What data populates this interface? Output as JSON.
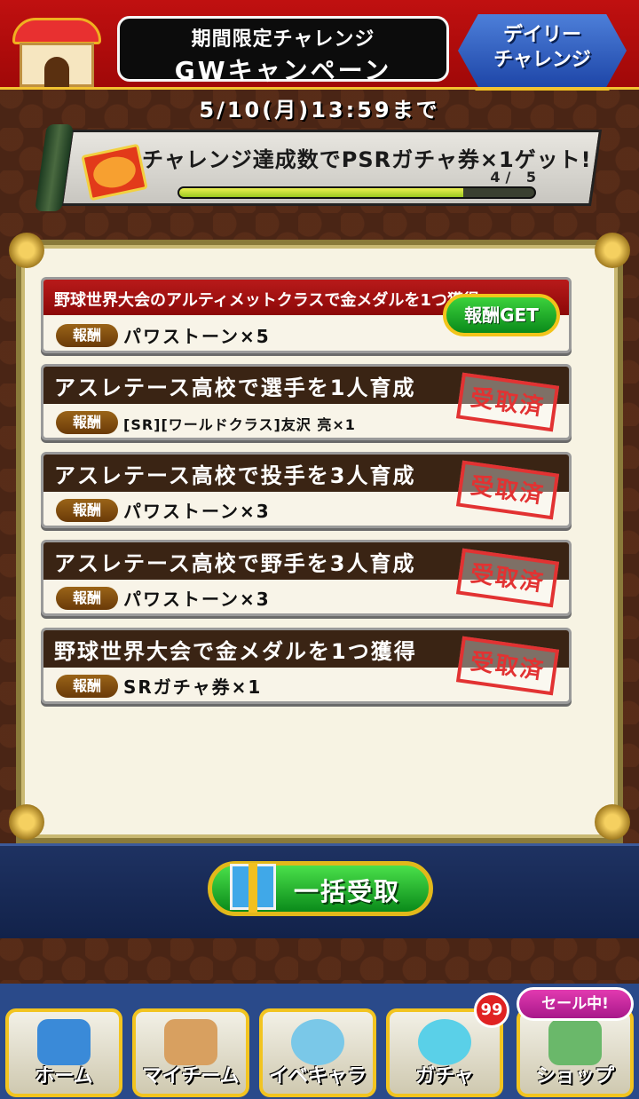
{
  "header": {
    "title_line1": "期間限定チャレンジ",
    "title_line2": "GWキャンペーン",
    "daily_button_label": "デイリーチャレンジ"
  },
  "deadline": "5/10(月)13:59まで",
  "banner": {
    "text": "チャレンジ達成数でPSRガチャ券×1ゲット!",
    "progress_text": "4/ 5",
    "progress_current": 4,
    "progress_total": 5
  },
  "tasks": [
    {
      "name": "野球世界大会のアルティメットクラスで金メダルを1つ獲得",
      "reward_tag": "報酬",
      "reward": "パワストーン×5",
      "action": "報酬GET"
    },
    {
      "name": "アスレテース高校で選手を1人育成",
      "reward_tag": "報酬",
      "reward": "[SR][ワールドクラス]友沢 亮×1",
      "status": "受取済"
    },
    {
      "name": "アスレテース高校で投手を3人育成",
      "reward_tag": "報酬",
      "reward": "パワストーン×3",
      "status": "受取済"
    },
    {
      "name": "アスレテース高校で野手を3人育成",
      "reward_tag": "報酬",
      "reward": "パワストーン×3",
      "status": "受取済"
    },
    {
      "name": "野球世界大会で金メダルを1つ獲得",
      "reward_tag": "報酬",
      "reward": "SRガチャ券×1",
      "status": "受取済"
    }
  ],
  "collect_all_label": "一括受取",
  "nav": {
    "items": [
      {
        "label": "ホーム",
        "icon": "home-book-icon"
      },
      {
        "label": "マイチーム",
        "icon": "team-players-icon"
      },
      {
        "label": "イベキャラ",
        "icon": "event-character-icon"
      },
      {
        "label": "ガチャ",
        "icon": "gacha-orb-icon"
      },
      {
        "label": "ショップ",
        "icon": "shop-store-icon"
      }
    ],
    "gacha_badge": "99",
    "shop_sale_label": "セール中!"
  },
  "colors": {
    "header_red": "#c01010",
    "accent_gold": "#f2c230",
    "stamp_red": "#e23232",
    "button_green": "#1aa62a"
  }
}
